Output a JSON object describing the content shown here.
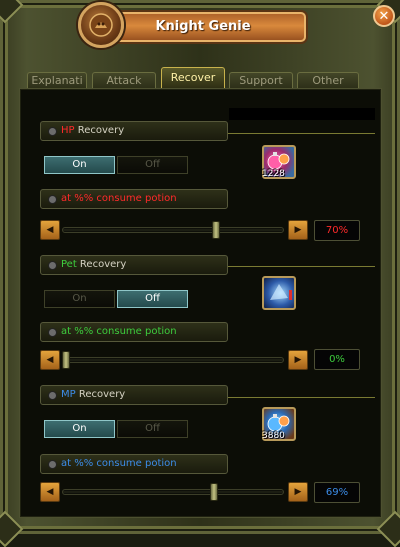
{
  "window": {
    "title": "Knight Genie",
    "close_glyph": "✕"
  },
  "tabs": [
    {
      "label": "Explanati"
    },
    {
      "label": "Attack"
    },
    {
      "label": "Recover"
    },
    {
      "label": "Support"
    },
    {
      "label": "Other"
    }
  ],
  "active_tab": "Recover",
  "sections": [
    {
      "name_colored": "HP",
      "name_rest": " Recovery",
      "name_color": "#ff2a2a",
      "toggle_on": "On",
      "toggle_off": "Off",
      "state": "On",
      "potion_count": "1228",
      "icon": "hp-potion-icon",
      "consume_label": "at %% consume potion",
      "consume_color": "#ff2a2a",
      "threshold_percent": 70,
      "value_text": "70%",
      "value_color": "#ff2a2a"
    },
    {
      "name_colored": "Pet",
      "name_rest": " Recovery",
      "name_color": "#3dcc3d",
      "toggle_on": "On",
      "toggle_off": "Off",
      "state": "Off",
      "potion_count": "",
      "icon": "pet-potion-icon",
      "consume_label": "at %% consume potion",
      "consume_color": "#3dcc3d",
      "threshold_percent": 0,
      "value_text": "0%",
      "value_color": "#3dcc3d"
    },
    {
      "name_colored": "MP",
      "name_rest": " Recovery",
      "name_color": "#3c8ce8",
      "toggle_on": "On",
      "toggle_off": "Off",
      "state": "On",
      "potion_count": "3880",
      "icon": "mp-potion-icon",
      "consume_label": "at %% consume potion",
      "consume_color": "#3c8ce8",
      "threshold_percent": 69,
      "value_text": "69%",
      "value_color": "#3c8ce8"
    }
  ],
  "colors": {
    "title_bar": "#d9893c",
    "toggle_on": "#3d6d70",
    "arrow_button": "#e4a33c"
  }
}
